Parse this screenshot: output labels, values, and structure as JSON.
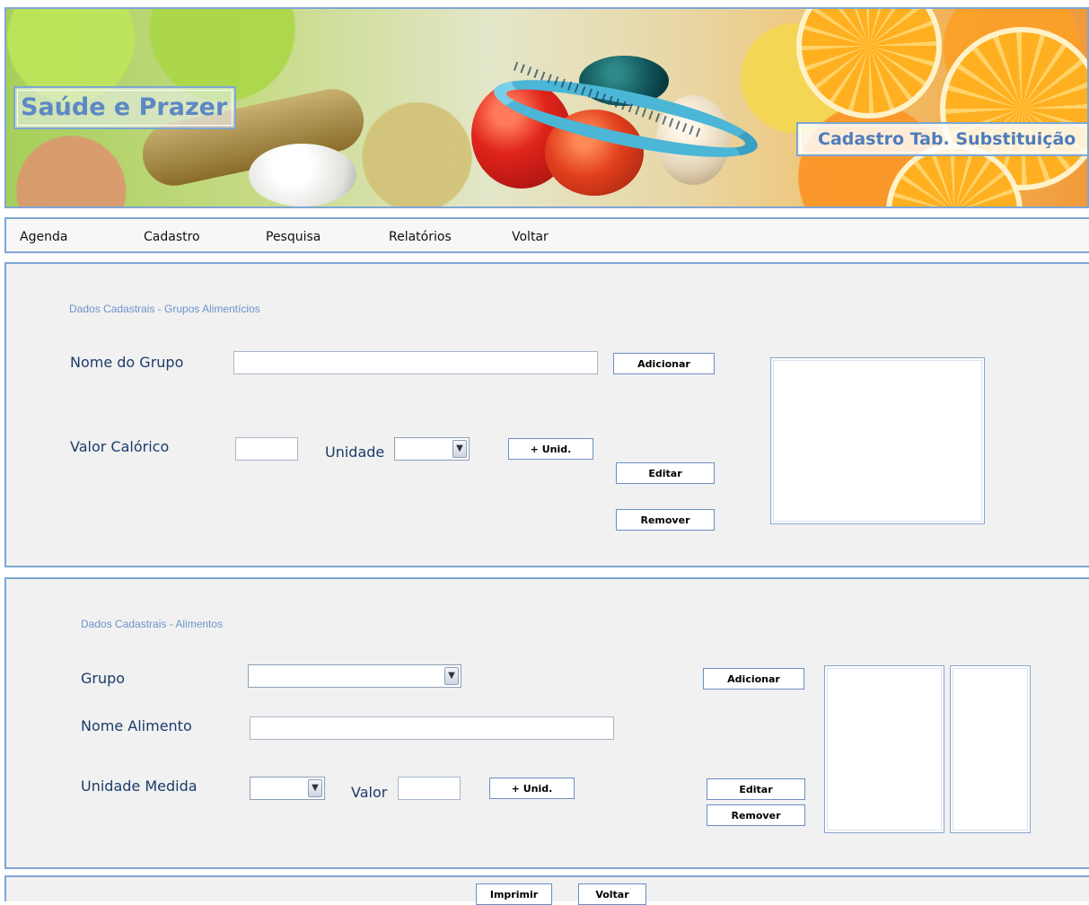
{
  "banner": {
    "brand": "Saúde e Prazer",
    "page_label": "Cadastro Tab. Substituição"
  },
  "menu": {
    "items": [
      "Agenda",
      "Cadastro",
      "Pesquisa",
      "Relatórios",
      "Voltar"
    ]
  },
  "grupos": {
    "section_title": "Dados Cadastrais - Grupos Alimentícios",
    "nome_label": "Nome do Grupo",
    "nome_value": "",
    "valor_label": "Valor Calórico",
    "valor_value": "",
    "unidade_label": "Unidade",
    "unidade_value": "",
    "add_unit_label": "+ Unid.",
    "adicionar_label": "Adicionar",
    "editar_label": "Editar",
    "remover_label": "Remover"
  },
  "alimentos": {
    "section_title": "Dados Cadastrais - Alimentos",
    "grupo_label": "Grupo",
    "grupo_value": "",
    "nome_label": "Nome Alimento",
    "nome_value": "",
    "unidade_label": "Unidade Medida",
    "unidade_value": "",
    "valor_label": "Valor",
    "valor_value": "",
    "add_unit_label": "+ Unid.",
    "adicionar_label": "Adicionar",
    "editar_label": "Editar",
    "remover_label": "Remover"
  },
  "footer": {
    "imprimir_label": "Imprimir",
    "voltar_label": "Voltar"
  },
  "colors": {
    "accent_border": "#7ea6d6",
    "panel_bg": "#f1f1f1",
    "label_text": "#1b3b6a",
    "section_title": "#6d93c9"
  }
}
